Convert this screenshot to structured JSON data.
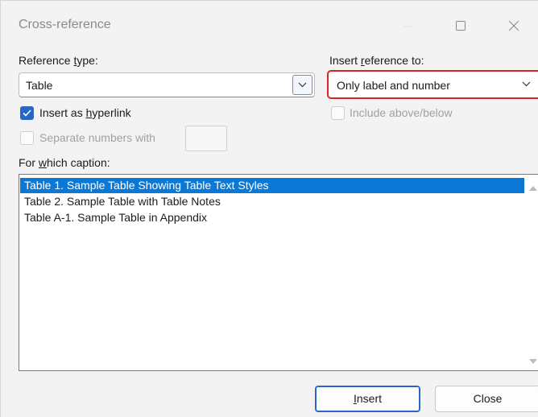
{
  "window": {
    "title": "Cross-reference"
  },
  "reference_type": {
    "label_pre": "Reference ",
    "label_key": "t",
    "label_post": "ype:",
    "value": "Table"
  },
  "insert_reference": {
    "label_pre": "Insert ",
    "label_key": "r",
    "label_post": "eference to:",
    "value": "Only label and number"
  },
  "hyperlink": {
    "label_pre": "Insert as ",
    "label_key": "h",
    "label_post": "yperlink",
    "checked": true
  },
  "include_above_below": {
    "label": "Include above/below",
    "checked": false,
    "enabled": false
  },
  "separate_numbers": {
    "label": "Separate numbers with",
    "checked": false,
    "enabled": false,
    "value": ""
  },
  "caption": {
    "label_pre": "For ",
    "label_key": "w",
    "label_post": "hich caption:",
    "items": [
      "Table 1. Sample Table Showing Table Text Styles",
      "Table 2. Sample Table with Table Notes",
      "Table A-1. Sample Table in Appendix"
    ],
    "selected_index": 0
  },
  "buttons": {
    "insert_key": "I",
    "insert_rest": "nsert",
    "close": "Close"
  },
  "colors": {
    "accent": "#2a66c7",
    "selection": "#0a78d4",
    "highlight_border": "#d8232a"
  }
}
